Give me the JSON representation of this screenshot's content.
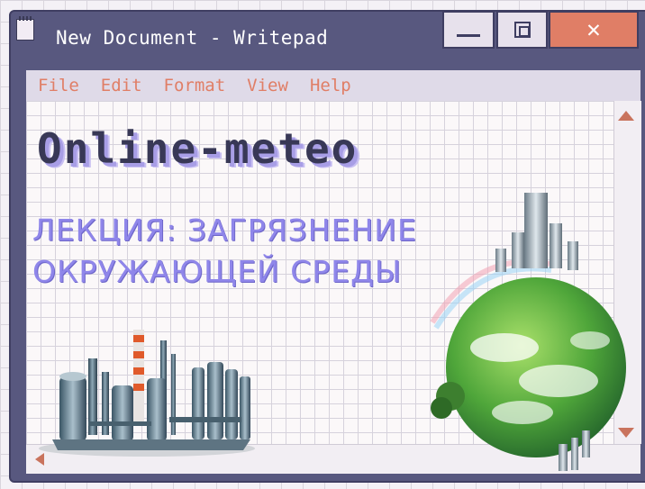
{
  "window": {
    "title": "New Document - Writepad",
    "close_glyph": "✕",
    "icons": {
      "app": "notepad-icon",
      "minimize": "minimize-icon",
      "maximize": "maximize-icon",
      "close": "close-icon"
    }
  },
  "menu": [
    "File",
    "Edit",
    "Format",
    "View",
    "Help"
  ],
  "document": {
    "headline": "Online-meteo",
    "subtitle_line1": "ЛЕКЦИЯ: ЗАГРЯЗНЕНИЕ",
    "subtitle_line2": "ОКРУЖАЮЩЕЙ СРЕДЫ"
  },
  "colors": {
    "window_frame": "#58587f",
    "menu_text": "#e07e66",
    "close_button": "#e07e66",
    "headline_text": "#383856",
    "subtitle_text": "#8f86ea"
  }
}
